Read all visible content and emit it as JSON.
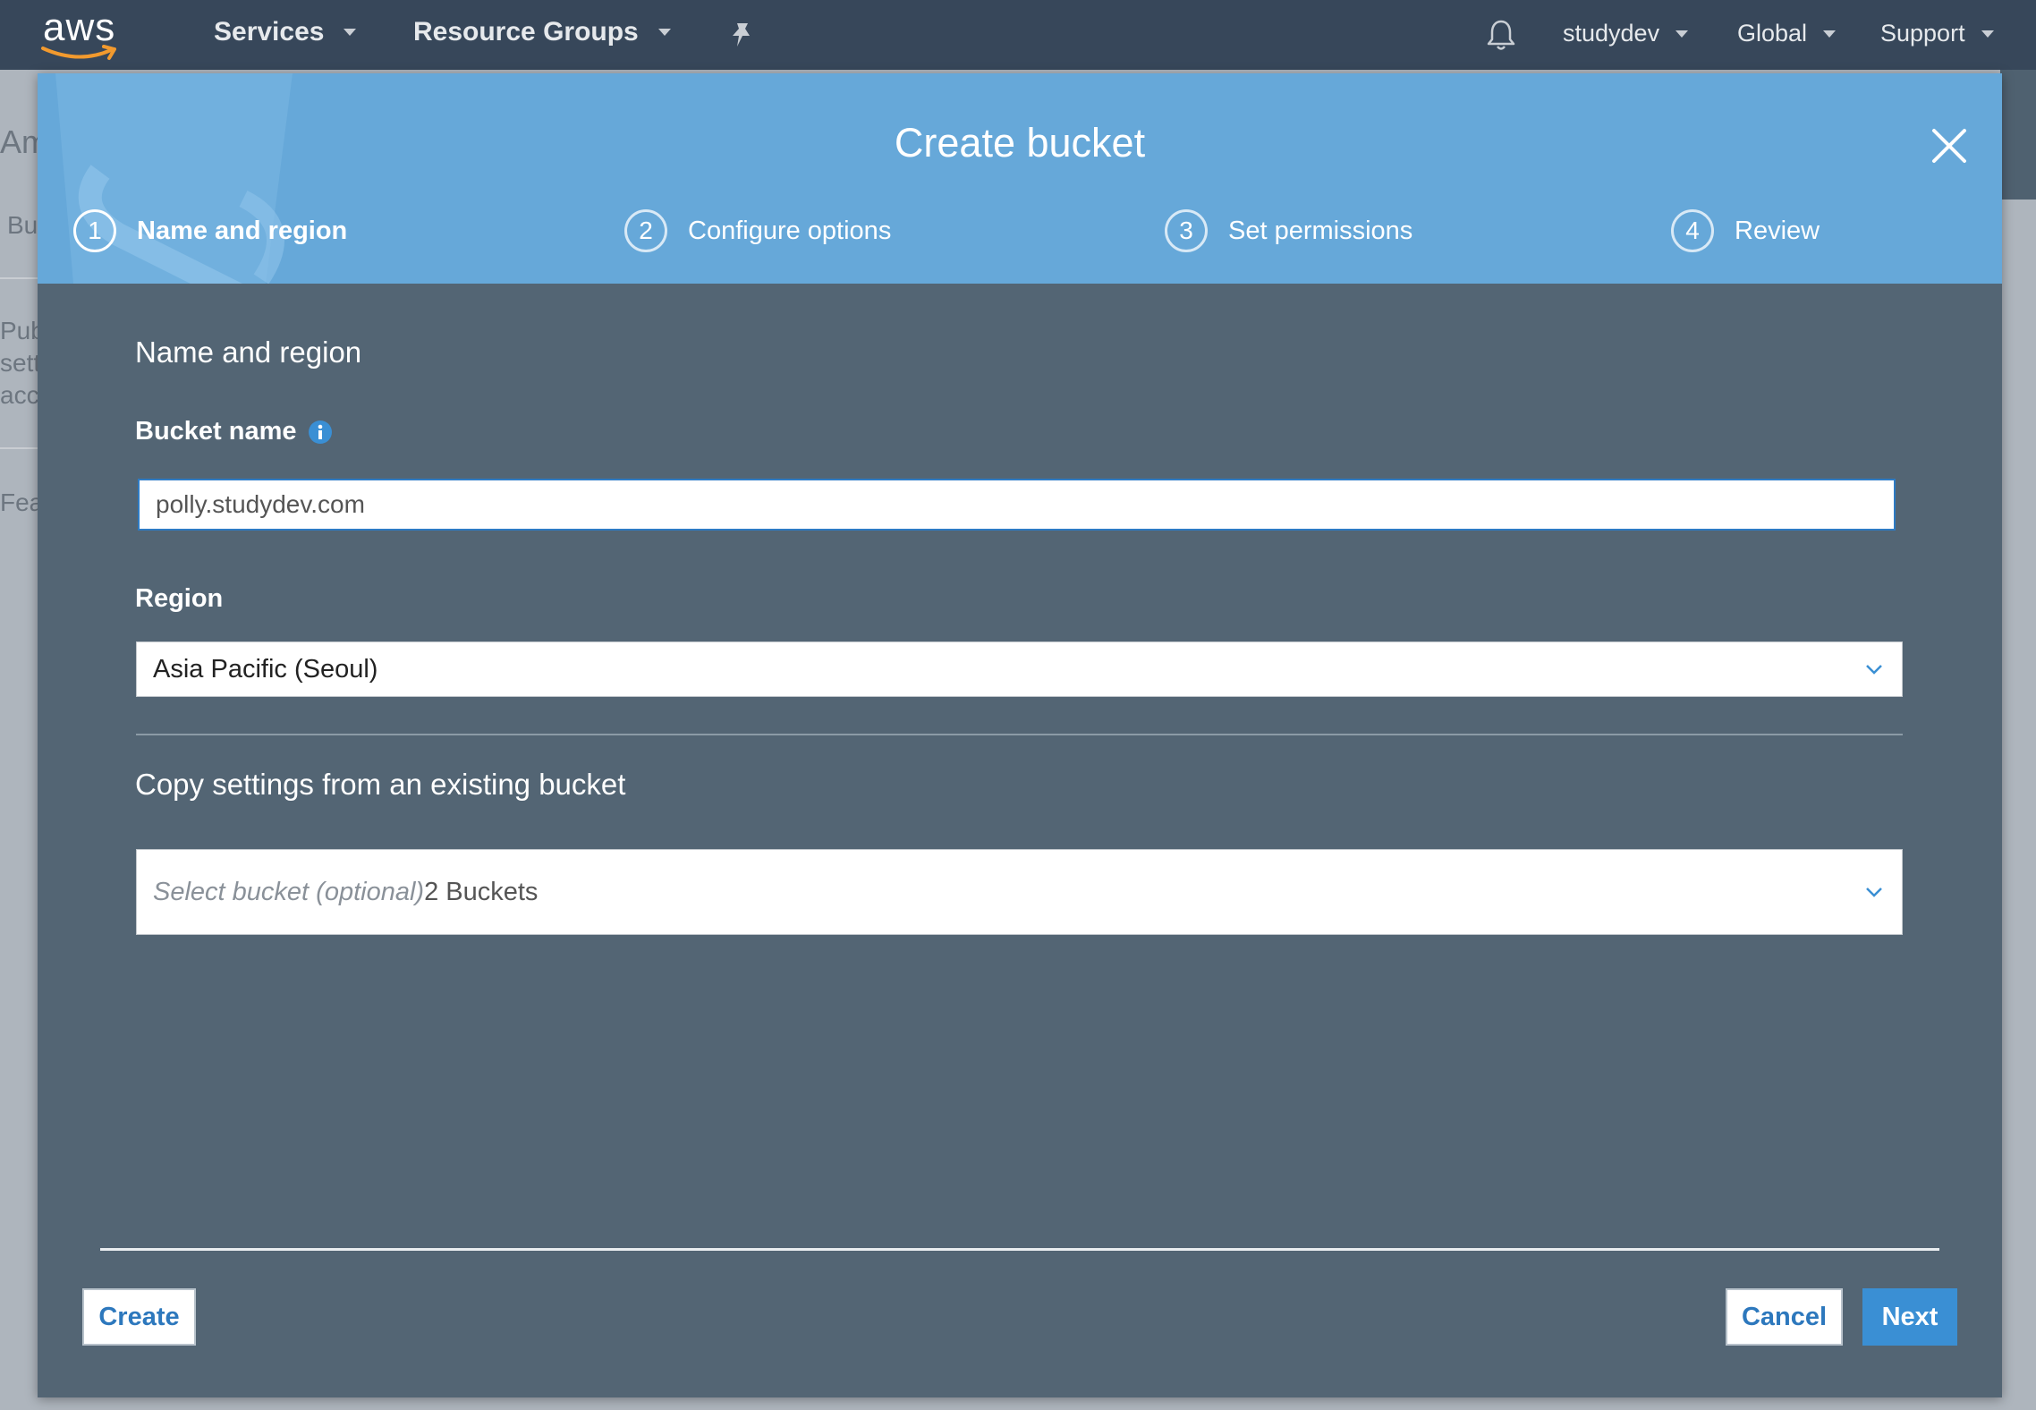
{
  "topnav": {
    "logo_text": "aws",
    "services": "Services",
    "resource_groups": "Resource Groups",
    "account": "studydev",
    "region": "Global",
    "support": "Support"
  },
  "background_page": {
    "fragments": [
      "Am",
      "Bu",
      "Publ",
      "setti",
      "acco",
      "Feat"
    ]
  },
  "modal": {
    "title": "Create bucket",
    "steps": [
      {
        "number": "1",
        "label": "Name and region",
        "active": true
      },
      {
        "number": "2",
        "label": "Configure options",
        "active": false
      },
      {
        "number": "3",
        "label": "Set permissions",
        "active": false
      },
      {
        "number": "4",
        "label": "Review",
        "active": false
      }
    ],
    "section_title": "Name and region",
    "bucket_name": {
      "label": "Bucket name",
      "value": "polly.studydev.com"
    },
    "region": {
      "label": "Region",
      "selected": "Asia Pacific (Seoul)"
    },
    "copy_settings": {
      "title": "Copy settings from an existing bucket",
      "placeholder": "Select bucket (optional)",
      "count": "2 Buckets"
    },
    "buttons": {
      "create": "Create",
      "cancel": "Cancel",
      "next": "Next"
    }
  },
  "colors": {
    "nav_bg": "#37475a",
    "header_bg": "#66a8d9",
    "modal_body": "#536574",
    "primary": "#3a8fd4"
  }
}
